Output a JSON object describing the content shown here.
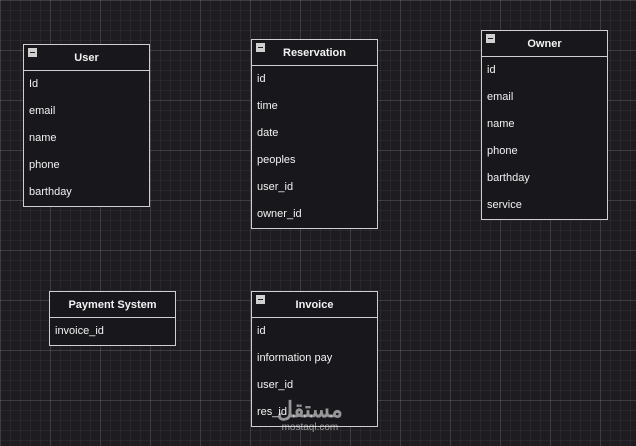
{
  "entities": [
    {
      "id": "user",
      "title": "User",
      "fields": [
        "Id",
        "email",
        "name",
        "phone",
        "barthday"
      ]
    },
    {
      "id": "reservation",
      "title": "Reservation",
      "fields": [
        "id",
        "time",
        "date",
        "peoples",
        "user_id",
        "owner_id"
      ]
    },
    {
      "id": "owner",
      "title": "Owner",
      "fields": [
        "id",
        "email",
        "name",
        "phone",
        "barthday",
        "service"
      ]
    },
    {
      "id": "payment-system",
      "title": "Payment System",
      "fields": [
        "invoice_id"
      ]
    },
    {
      "id": "invoice",
      "title": "Invoice",
      "fields": [
        "id",
        "information pay",
        "user_id",
        "res_id"
      ]
    }
  ],
  "watermark": {
    "main": "مستقل",
    "sub": "mostaql.com"
  }
}
